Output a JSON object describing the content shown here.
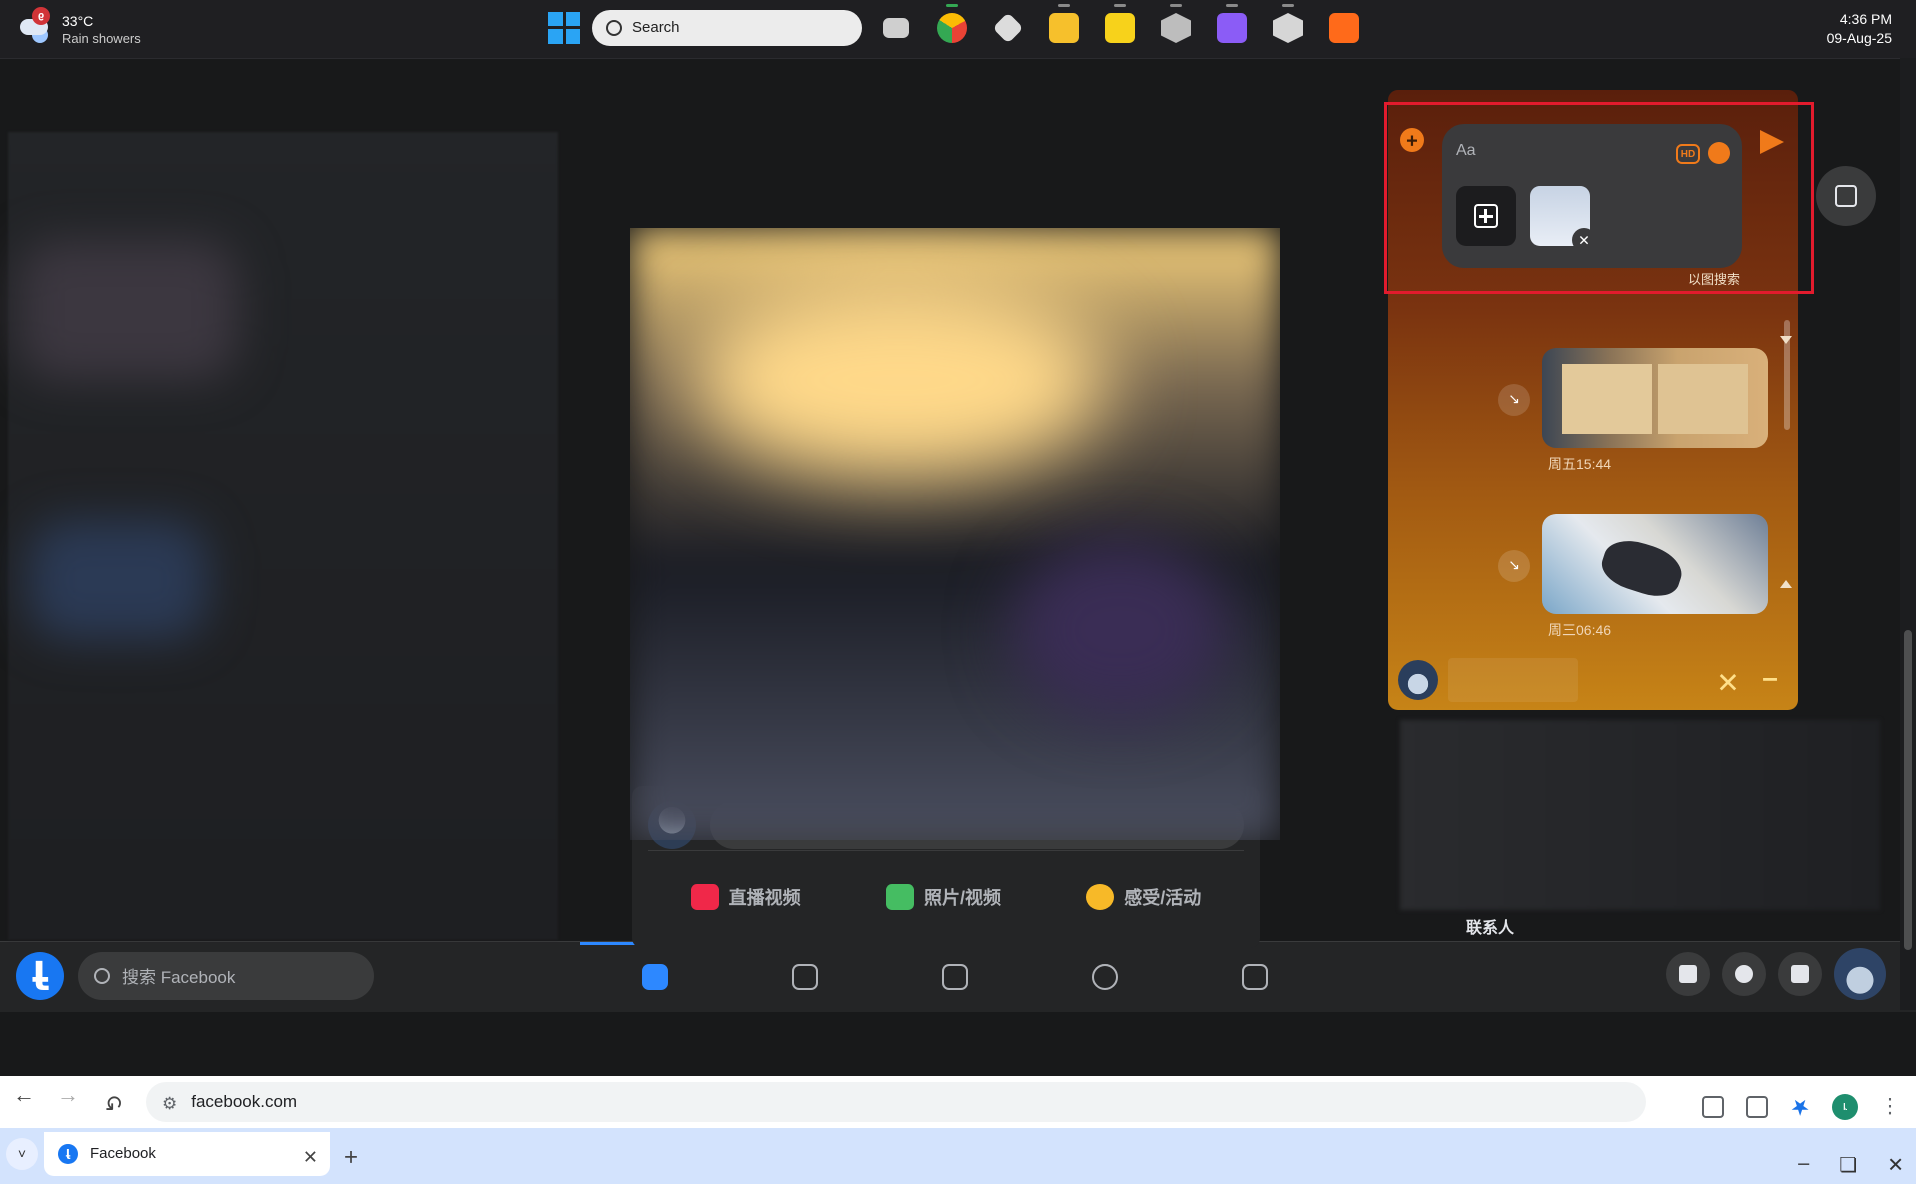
{
  "taskbar": {
    "weather_temp": "33°C",
    "weather_condition": "Rain showers",
    "weather_badge": "6",
    "search_placeholder": "Search",
    "apps": [
      "windows-start",
      "task-view",
      "chrome",
      "unity",
      "file-explorer",
      "sticky-notes",
      "photoshop-like",
      "visual-studio",
      "unity-hub",
      "sublime"
    ],
    "time": "4:36 PM",
    "date": "09-Aug-25"
  },
  "facebook": {
    "search_placeholder": "搜索 Facebook",
    "composer_actions": [
      "直播视频",
      "照片/视频",
      "感受/活动"
    ],
    "contacts_label": "联系人"
  },
  "chat": {
    "timestamps": [
      "周三06:46",
      "周五15:44"
    ],
    "partial_label": "以图搜索",
    "input_placeholder": "Aa",
    "hd_label": "HD",
    "minimize": "–",
    "close": "✕"
  },
  "browser": {
    "tab_title": "Facebook",
    "url": "facebook.com",
    "profile_initial": "r"
  },
  "colors": {
    "chat_accent": "#f07a1a",
    "highlight_frame": "#e21b2d",
    "facebook_blue": "#1877f2"
  }
}
